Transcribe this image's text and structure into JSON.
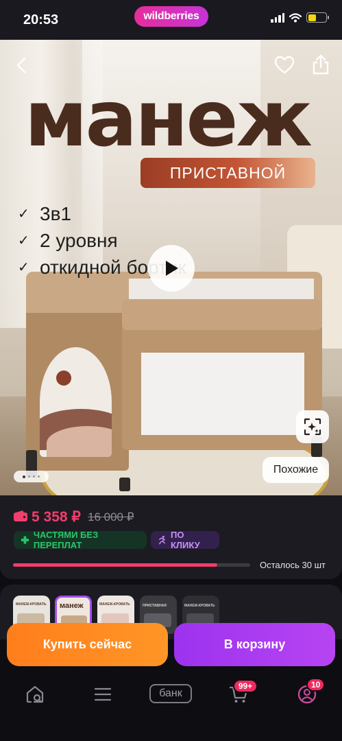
{
  "status_bar": {
    "time": "20:53",
    "logo": "wildberries"
  },
  "hero": {
    "title": "манеж",
    "badge": "ПРИСТАВНОЙ",
    "features": [
      "3в1",
      "2 уровня",
      "откидной бортик"
    ],
    "similar_label": "Похожие",
    "gallery_dots": 4,
    "gallery_active_index": 0
  },
  "price": {
    "current": "5 358 ₽",
    "old": "16 000 ₽",
    "installment_tag": "ЧАСТЯМИ БЕЗ ПЕРЕПЛАТ",
    "click_tag": "ПО КЛИКУ",
    "stock_text": "Осталось 30 шт",
    "stock_progress_fraction": 0.86
  },
  "variants": {
    "items": [
      {
        "label": "МАНЕЖ-КРОВАТЬ",
        "selected": false
      },
      {
        "label": "манеж",
        "selected": true
      },
      {
        "label": "МАНЕЖ-КРОВАТЬ",
        "selected": false
      },
      {
        "label": "ПРИСТАВНАЯ",
        "selected": false
      },
      {
        "label": "МАНЕЖ-КРОВАТЬ",
        "selected": false
      }
    ]
  },
  "actions": {
    "buy_now": "Купить сейчас",
    "add_to_cart": "В корзину"
  },
  "bottom_nav": {
    "bank_label": "банк",
    "cart_badge": "99+",
    "profile_badge": "10"
  },
  "colors": {
    "price_accent": "#f13e6c",
    "buy_button": "#ff8a20",
    "cart_button": "#a93ef0",
    "installment_green": "#28c56a",
    "click_purple": "#c591f3"
  },
  "icons": {
    "back": "chevron-left-icon",
    "favorite": "heart-icon",
    "share": "share-icon",
    "play": "play-icon",
    "ai_search": "ai-sparkle-search-icon",
    "home": "home-search-icon",
    "catalog": "menu-icon",
    "cart": "cart-icon",
    "profile": "profile-icon",
    "wallet": "wallet-icon"
  }
}
